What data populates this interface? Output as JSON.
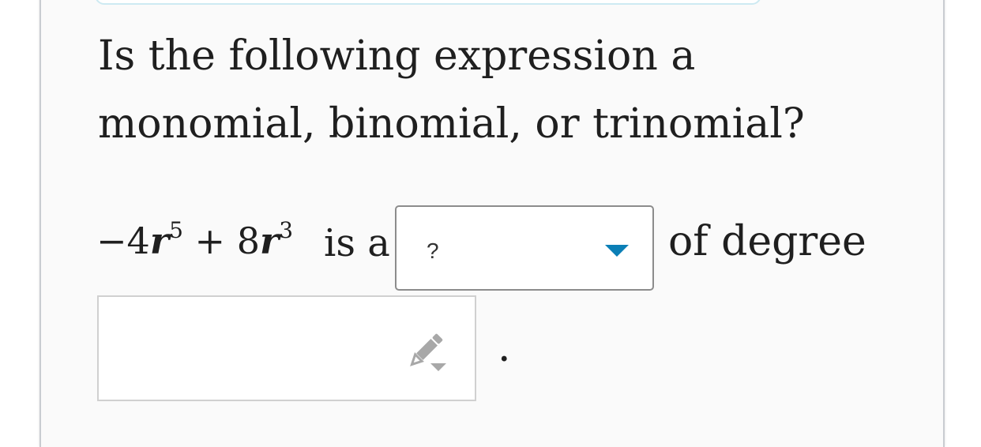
{
  "question": {
    "line1": "Is the following expression a",
    "line2": "monomial, binomial, or trinomial?"
  },
  "expression": {
    "minus": "−",
    "coef1": "4",
    "var1": "r",
    "exp1": "5",
    "plus": "+",
    "coef2": "8",
    "var2": "r",
    "exp2": "3"
  },
  "text_is_a": "is a",
  "dropdown": {
    "selected": "?"
  },
  "text_of_degree": "of degree",
  "answer_input": {
    "value": ""
  },
  "period": ".",
  "icons": {
    "caret": "chevron-down-icon",
    "pencil": "pencil-icon"
  },
  "colors": {
    "accent": "#0b7fb6",
    "text": "#1f1f1f"
  }
}
